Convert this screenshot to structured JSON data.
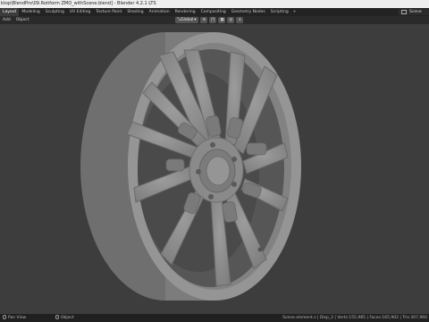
{
  "window": {
    "title": "ktop\\BlendPro\\09.Rotiform ZMO_withScene.blend] - Blender 4.2.1 LTS"
  },
  "workspaces": {
    "tabs": [
      "Layout",
      "Modeling",
      "Sculpting",
      "UV Editing",
      "Texture Paint",
      "Shading",
      "Animation",
      "Rendering",
      "Compositing",
      "Geometry Nodes",
      "Scripting"
    ],
    "active_index": 0,
    "add_label": "+",
    "scene": "Scene"
  },
  "viewport_header": {
    "menus": [
      "Add",
      "Object"
    ],
    "orientation": "Global"
  },
  "statusbar": {
    "left": "Pan View",
    "mid": "Object",
    "right": "Scene.element.s | Disp_2 | Verts:155,985 | Faces:165,902 | Tris:307,960"
  },
  "colors": {
    "viewport_bg": "#3d3d3d",
    "wheel": "#8f8f8f",
    "titlebar": "#eeeeee"
  }
}
